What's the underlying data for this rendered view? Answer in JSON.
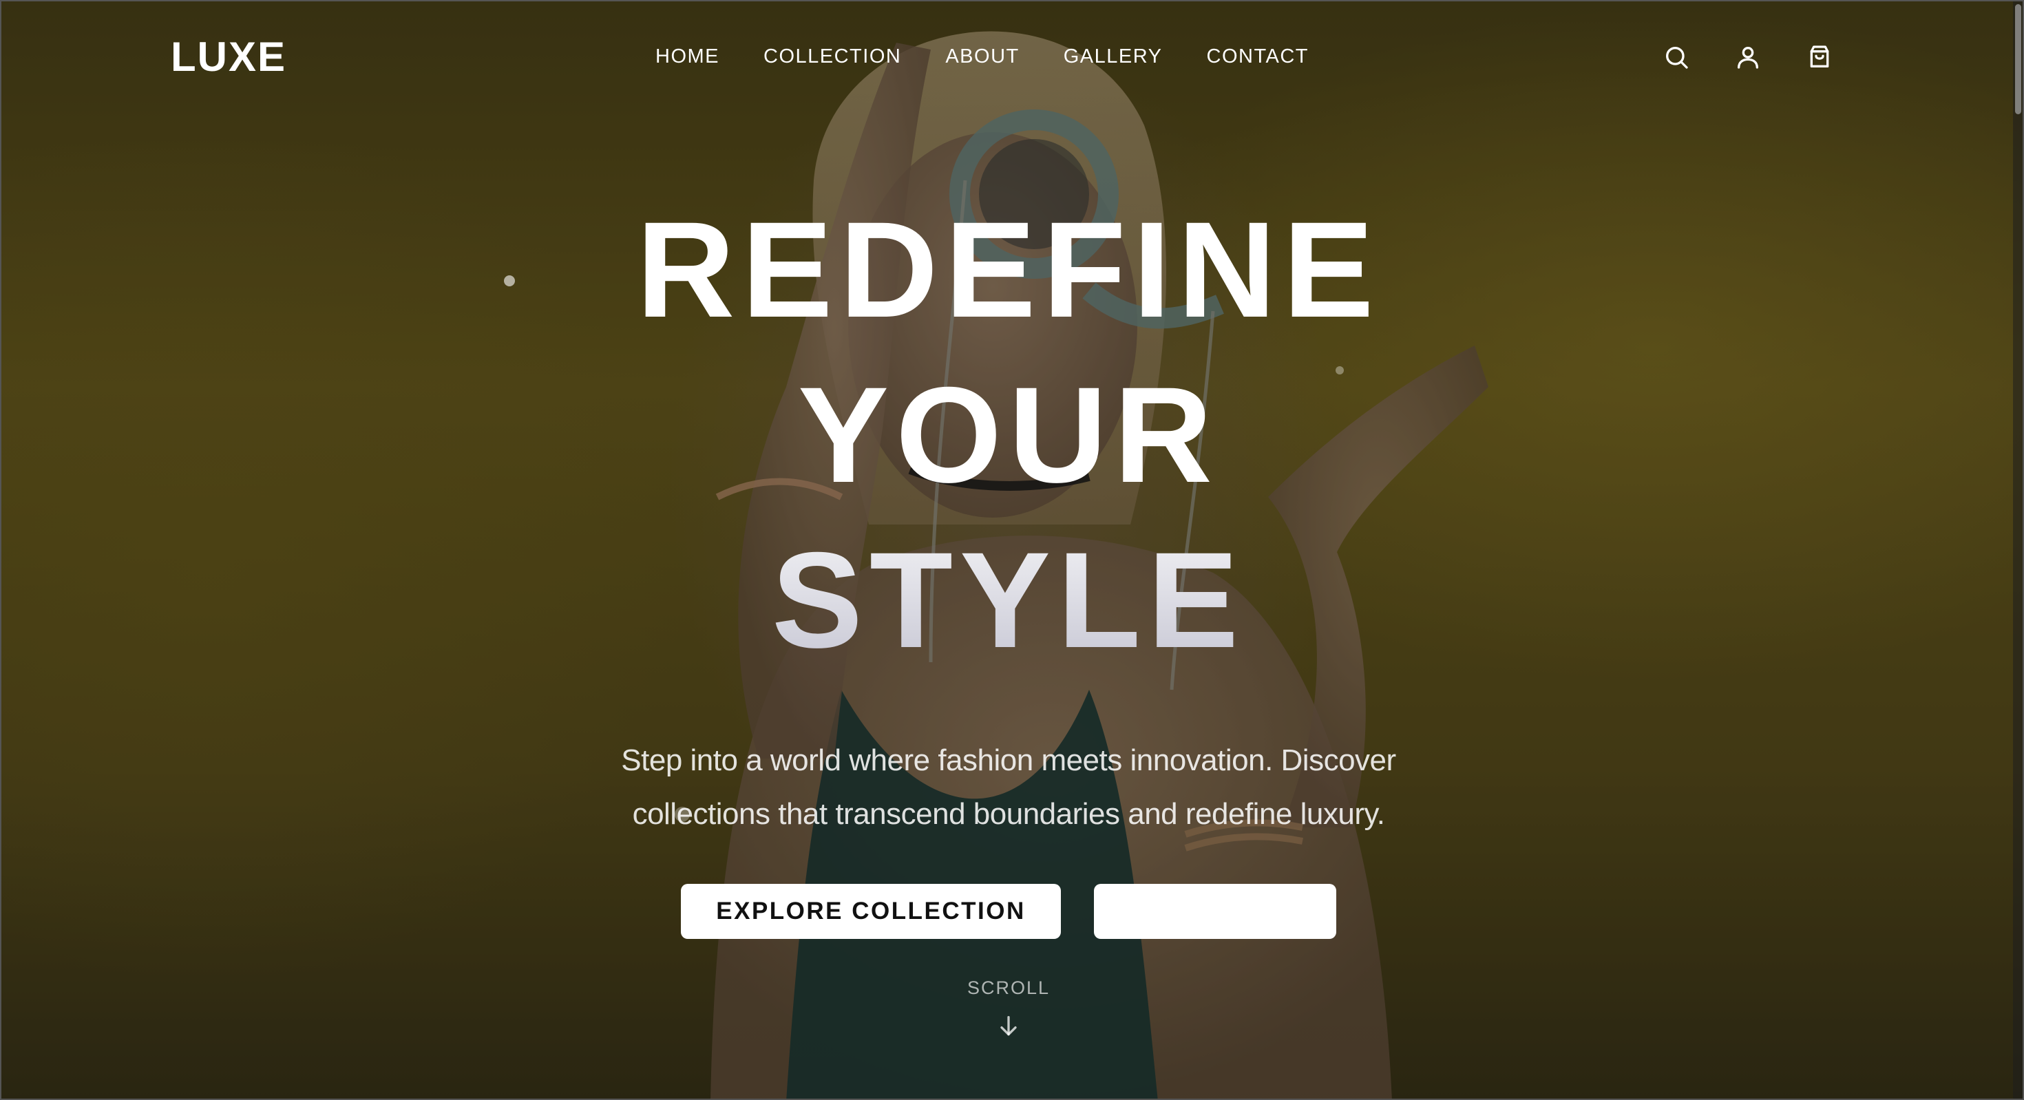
{
  "brand": {
    "logo": "LUXE"
  },
  "nav": {
    "links": [
      {
        "label": "HOME"
      },
      {
        "label": "COLLECTION"
      },
      {
        "label": "ABOUT"
      },
      {
        "label": "GALLERY"
      },
      {
        "label": "CONTACT"
      }
    ],
    "icons": [
      "search-icon",
      "user-icon",
      "shopping-bag-icon"
    ]
  },
  "hero": {
    "headline": [
      "REDEFINE",
      "YOUR",
      "STYLE"
    ],
    "subtitle": "Step into a world where fashion meets innovation. Discover collections that transcend boundaries and redefine luxury.",
    "primary_cta": "EXPLORE COLLECTION",
    "secondary_cta": "",
    "scroll_label": "SCROLL"
  },
  "colors": {
    "background_tint": "#5a4e1c",
    "text": "#ffffff",
    "button_bg": "#ffffff",
    "button_text": "#111111"
  }
}
